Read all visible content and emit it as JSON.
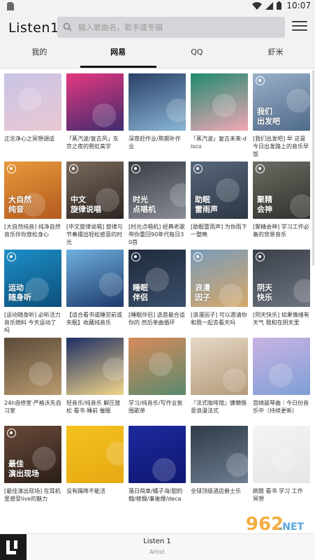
{
  "status": {
    "time": "10:07"
  },
  "app": {
    "title": "Listen1"
  },
  "search": {
    "placeholder": "输入歌曲名，歌手或专辑"
  },
  "tabs": [
    {
      "label": "我的",
      "active": false
    },
    {
      "label": "网易",
      "active": true
    },
    {
      "label": "QQ",
      "active": false
    },
    {
      "label": "虾米",
      "active": false
    }
  ],
  "playlists": [
    {
      "title": "正念净心之冥想调适",
      "cover_text": "",
      "colors": [
        "#c9c3e6",
        "#e9c8d3"
      ]
    },
    {
      "title": "「蒸汽波/复古风」东京之夜的霓虹美学",
      "cover_text": "",
      "colors": [
        "#e4387f",
        "#3f2b6e"
      ]
    },
    {
      "title": "深夜赶作业/熬期补作业",
      "cover_text": "",
      "colors": [
        "#2a3f66",
        "#8ab6d6"
      ]
    },
    {
      "title": "「蒸汽波」复古未来-disco",
      "cover_text": "",
      "colors": [
        "#1f8a6f",
        "#f3a7b6"
      ]
    },
    {
      "title": "[我们出发吧] 早 这是今日出发路上的音乐早饭",
      "cover_text": "我们\n出发吧",
      "colors": [
        "#9ab0c8",
        "#4f6a8a"
      ]
    },
    {
      "title": "[大自然纯音] 纯净自然音乐伴你放松身心",
      "cover_text": "大自然\n纯音",
      "colors": [
        "#e89a3b",
        "#b35a1f"
      ]
    },
    {
      "title": "[中文旋律说唱] 旋律与节奏摆出轻松感意的时光",
      "cover_text": "中文\n旋律说唱",
      "colors": [
        "#7b6a5c",
        "#2c2522"
      ]
    },
    {
      "title": "[时光点唱机] 经典老歌带你重回90年代每日30首",
      "cover_text": "时光\n点唱机",
      "colors": [
        "#3b3d45",
        "#8a8d96"
      ]
    },
    {
      "title": "[助眠雷雨声] 为你雨下一整晚",
      "cover_text": "助眠\n雷雨声",
      "colors": [
        "#58677a",
        "#2d3644"
      ]
    },
    {
      "title": "[聚精会神] 学习工作必备的背景音乐",
      "cover_text": "聚精\n会神",
      "colors": [
        "#6b6e64",
        "#2f302b"
      ]
    },
    {
      "title": "[运动随身听] 必听活力音乐燃料 今天运动了吗",
      "cover_text": "运动\n随身听",
      "colors": [
        "#1d8fc8",
        "#0d4f7a"
      ]
    },
    {
      "title": "【适合看书或睡觉前或失眠】收藏纯音乐",
      "cover_text": "",
      "colors": [
        "#6fb0e0",
        "#1d3a6a"
      ]
    },
    {
      "title": "[睡眠伴侣] 选首最合适你的 然后单曲循环",
      "cover_text": "睡眠\n伴侣",
      "colors": [
        "#1f2a3c",
        "#3b4f6a"
      ]
    },
    {
      "title": "[浪漫因子] 可以邀请你和我一起去看天吗",
      "cover_text": "浪漫\n因子",
      "colors": [
        "#7a9bb8",
        "#d6a86a"
      ]
    },
    {
      "title": "[阴天快乐] 如果情绪有天气 我和在阴天里",
      "cover_text": "阴天\n快乐",
      "colors": [
        "#3a4048",
        "#6e7480"
      ]
    },
    {
      "title": "24h自修室·严格沃先自习室",
      "cover_text": "",
      "colors": [
        "#5a4a3a",
        "#b89a6e"
      ]
    },
    {
      "title": "轻音乐/纯音乐 解压放松 看书 睡前 催眠",
      "cover_text": "",
      "colors": [
        "#1d2e63",
        "#f2d58a"
      ]
    },
    {
      "title": "学习/纯音乐/写作业氛围歌单",
      "cover_text": "",
      "colors": [
        "#d78a5a",
        "#5a8a6e"
      ]
    },
    {
      "title": "『法式咖啡馆』慵懒惬意浪漫法式",
      "cover_text": "",
      "colors": [
        "#e6d8c6",
        "#b49a7a"
      ]
    },
    {
      "title": "宫崎骏琴曲｜今日份音乐中（持续更新）",
      "cover_text": "",
      "colors": [
        "#c9b3e3",
        "#7f9fd6"
      ]
    },
    {
      "title": "[最佳演出现场] 在耳机里感受live的魅力",
      "cover_text": "最佳\n演出现场",
      "colors": [
        "#6a4a3a",
        "#2a1e18"
      ]
    },
    {
      "title": "没有躁降不能活",
      "cover_text": "",
      "colors": [
        "#f4c21f",
        "#e6a812"
      ]
    },
    {
      "title": "落日飛車/橘子海/甜約翰/棱鏡/事後煙/deca",
      "cover_text": "",
      "colors": [
        "#1d2a9e",
        "#0e1770"
      ]
    },
    {
      "title": "全球顶级酒店爵士乐",
      "cover_text": "",
      "colors": [
        "#2e3a48",
        "#6e7e90"
      ]
    },
    {
      "title": "刷题 看书 学习 工作 冥想",
      "cover_text": "",
      "colors": [
        "#f4f4f4",
        "#e6e6e6"
      ]
    }
  ],
  "player": {
    "song": "Listen 1",
    "artist": "Artist"
  }
}
